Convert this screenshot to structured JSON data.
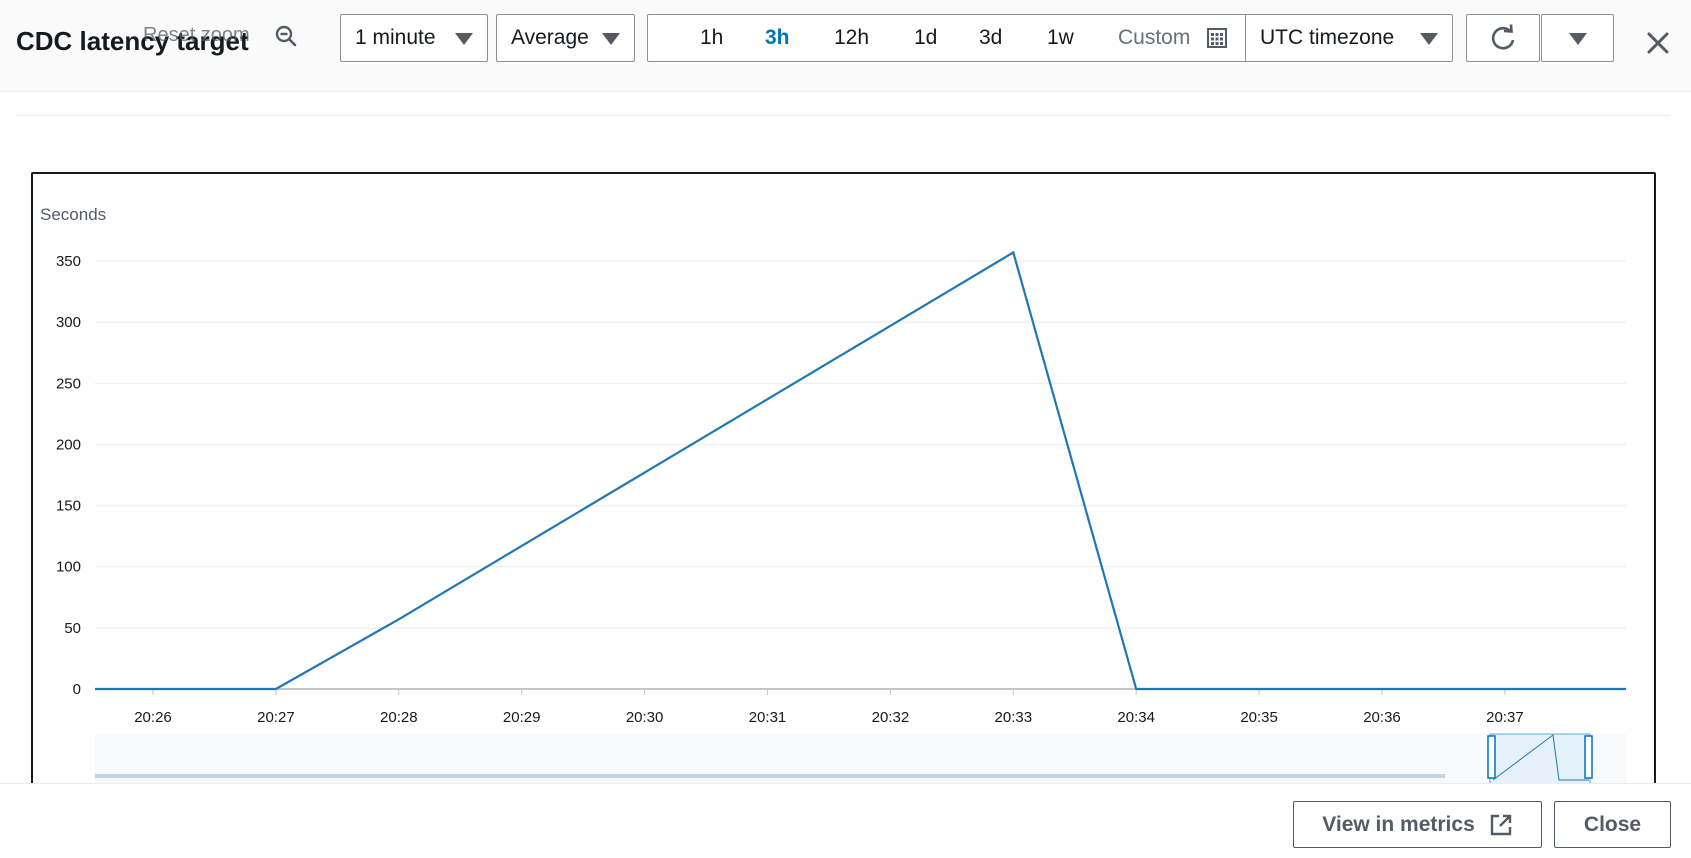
{
  "header": {
    "title": "CDC latency target",
    "reset_zoom": "Reset zoom",
    "period": "1 minute",
    "statistic": "Average",
    "ranges": [
      "1h",
      "3h",
      "12h",
      "1d",
      "3d",
      "1w"
    ],
    "active_range": "3h",
    "custom_label": "Custom",
    "timezone": "UTC timezone"
  },
  "footer": {
    "view_in_metrics": "View in metrics",
    "close": "Close"
  },
  "colors": {
    "accent": "#0073bb",
    "series": "#1f77b4"
  },
  "chart_data": {
    "type": "line",
    "ylabel": "Seconds",
    "ylim": [
      0,
      350
    ],
    "yticks": [
      0,
      50,
      100,
      150,
      200,
      250,
      300,
      350
    ],
    "xticks": [
      "20:26",
      "20:27",
      "20:28",
      "20:29",
      "20:30",
      "20:31",
      "20:32",
      "20:33",
      "20:34",
      "20:35",
      "20:36",
      "20:37"
    ],
    "series": [
      {
        "x": [
          "20:26",
          "20:27",
          "20:28",
          "20:29",
          "20:30",
          "20:31",
          "20:32",
          "20:33",
          "20:34",
          "20:35",
          "20:36",
          "20:37"
        ],
        "values": [
          0,
          0,
          57,
          117,
          177,
          237,
          297,
          357,
          0,
          0,
          0,
          0
        ]
      }
    ]
  }
}
